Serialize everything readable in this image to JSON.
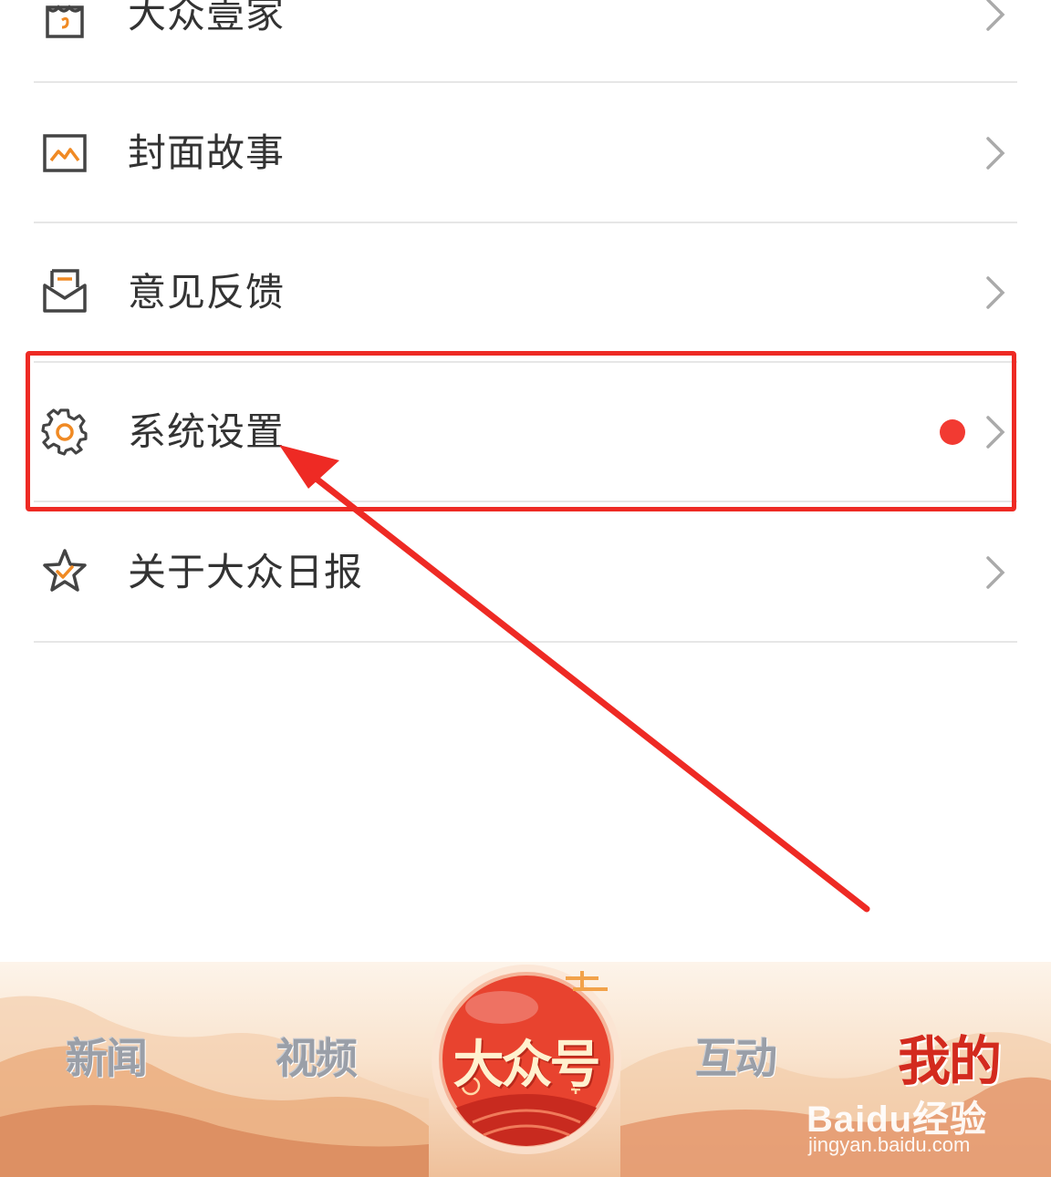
{
  "menu": {
    "items": [
      {
        "label": "大众壹家",
        "icon": "shop-icon"
      },
      {
        "label": "封面故事",
        "icon": "image-icon"
      },
      {
        "label": "意见反馈",
        "icon": "envelope-icon"
      },
      {
        "label": "系统设置",
        "icon": "gear-icon",
        "badge": "red-dot"
      },
      {
        "label": "关于大众日报",
        "icon": "star-icon"
      }
    ]
  },
  "annotation": {
    "color": "#ee2a24",
    "target": "系统设置"
  },
  "tabbar": {
    "tabs": [
      {
        "label": "新闻",
        "active": false
      },
      {
        "label": "视频",
        "active": false
      },
      {
        "label": "大众号",
        "active": false,
        "center": true
      },
      {
        "label": "互动",
        "active": false
      },
      {
        "label": "我的",
        "active": true
      }
    ]
  },
  "watermark": {
    "brand": "Baidu经验",
    "url": "jingyan.baidu.com"
  },
  "colors": {
    "icon_orange": "#f08a24",
    "icon_gray": "#444444",
    "badge_red": "#f23a32",
    "active_tab": "#d32a1e"
  }
}
